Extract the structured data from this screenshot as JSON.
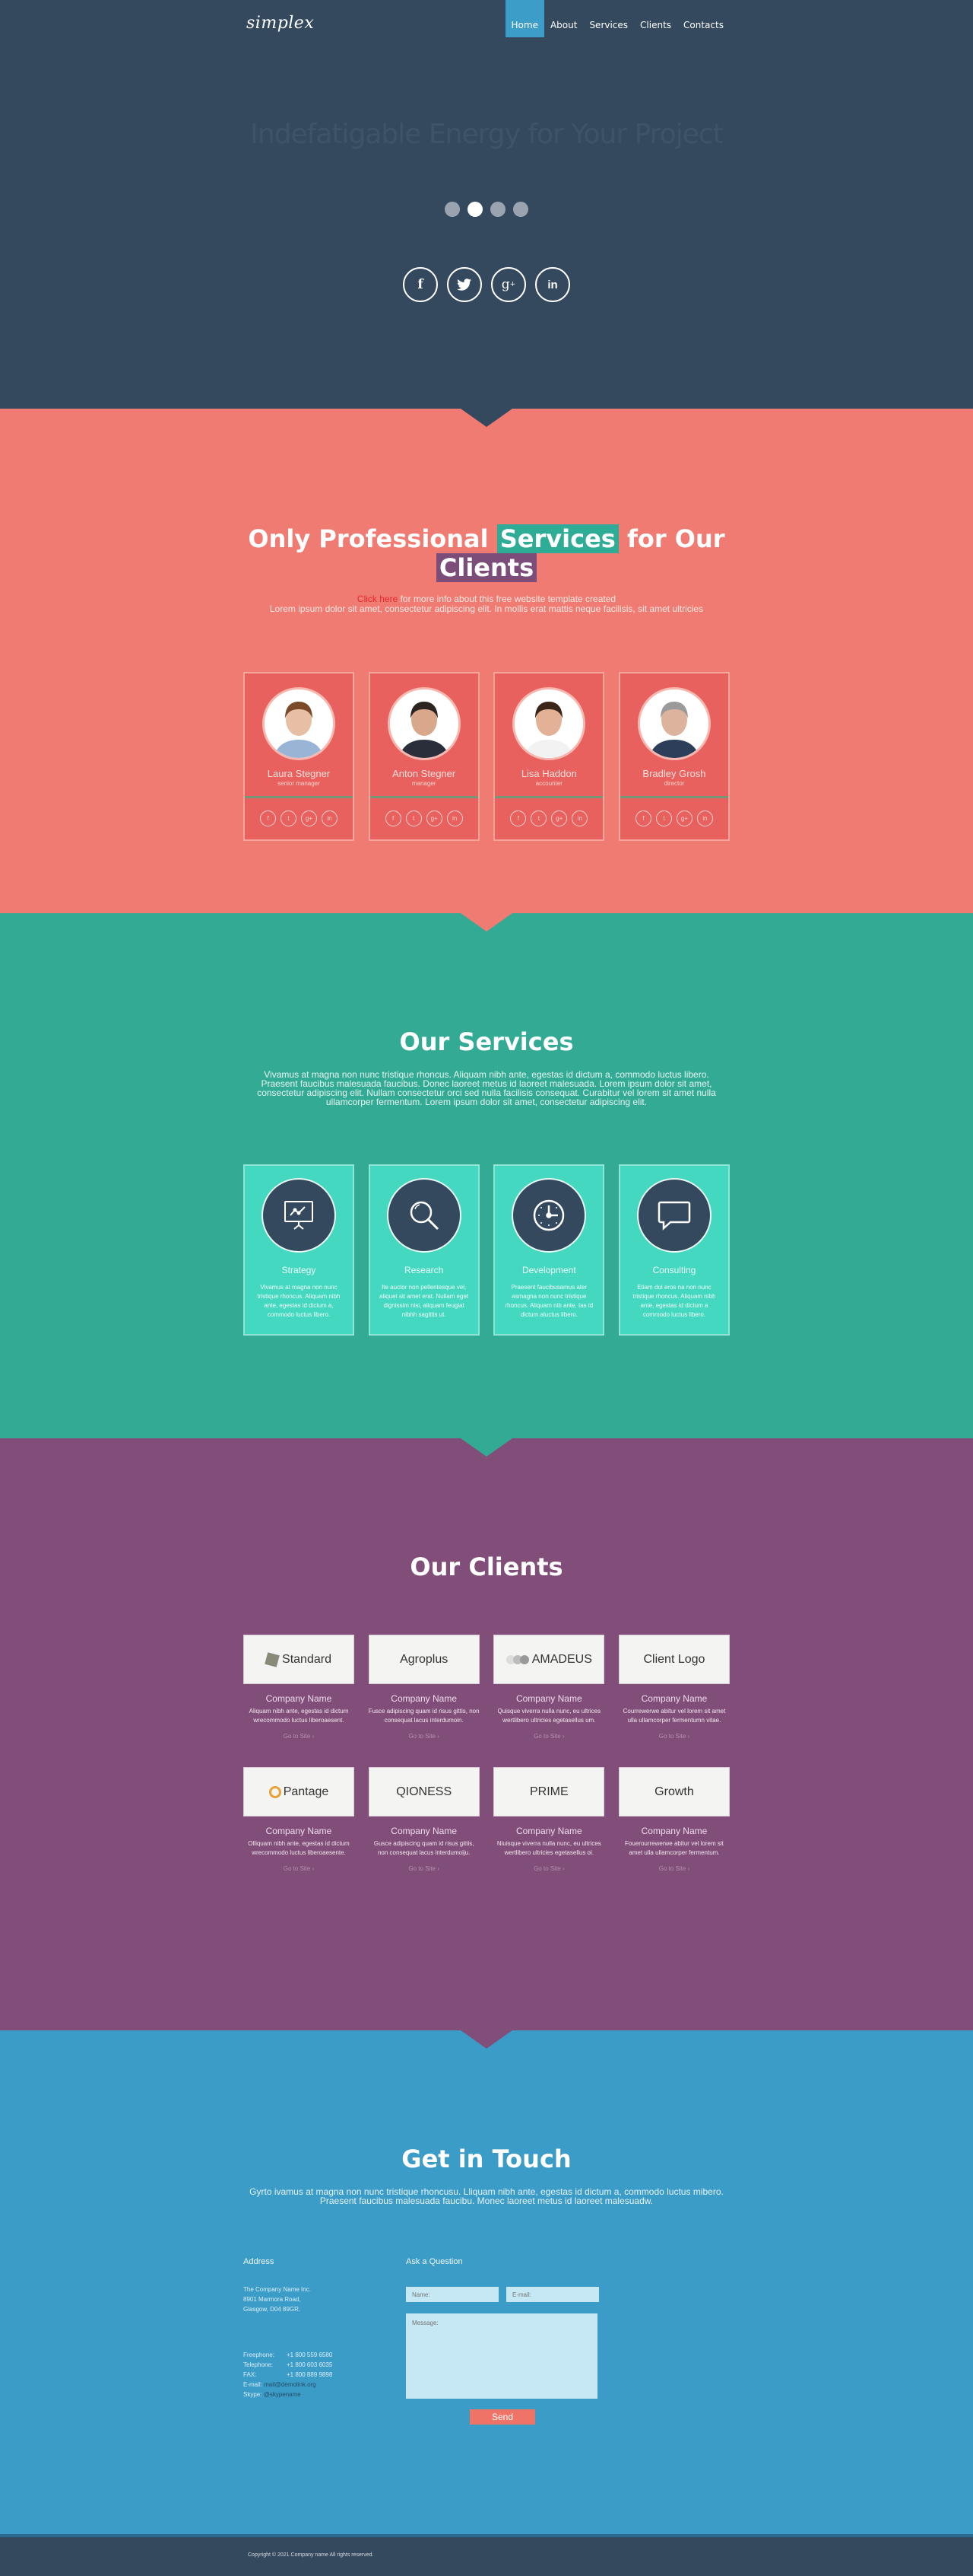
{
  "header": {
    "logo": "simplex",
    "nav": [
      {
        "label": "Home",
        "active": true
      },
      {
        "label": "About",
        "active": false
      },
      {
        "label": "Services",
        "active": false
      },
      {
        "label": "Clients",
        "active": false
      },
      {
        "label": "Contacts",
        "active": false
      }
    ]
  },
  "hero": {
    "title": "Indefatigable Energy for Your Project",
    "slider_dots": 4,
    "active_dot": 2,
    "social": [
      {
        "icon": "facebook-icon",
        "glyph": "f"
      },
      {
        "icon": "twitter-icon",
        "glyph": "t"
      },
      {
        "icon": "google-plus-icon",
        "glyph": "g+"
      },
      {
        "icon": "linkedin-icon",
        "glyph": "in"
      }
    ]
  },
  "team": {
    "title_pre": "Only Professional",
    "title_hl1": "Services",
    "title_mid": "for Our",
    "title_hl2": "Clients",
    "link_text": "Click here",
    "intro_line1_rest": " for more info about this free website template created",
    "intro_line2": "Lorem ipsum dolor sit amet, consectetur adipiscing elit. In mollis erat mattis neque facilisis, sit amet ultricies",
    "members": [
      {
        "name": "Laura Stegner",
        "role": "senior manager"
      },
      {
        "name": "Anton Stegner",
        "role": "manager"
      },
      {
        "name": "Lisa Haddon",
        "role": "accounter"
      },
      {
        "name": "Bradley Grosh",
        "role": "director"
      }
    ],
    "member_social": [
      "f",
      "t",
      "g+",
      "in"
    ]
  },
  "services": {
    "title": "Our Services",
    "description": "Vivamus at magna non nunc tristique rhoncus. Aliquam nibh ante, egestas id dictum a, commodo luctus libero. Praesent faucibus malesuada faucibus. Donec laoreet metus id laoreet malesuada. Lorem ipsum dolor sit amet, consectetur adipiscing elit. Nullam consectetur orci sed nulla facilisis consequat. Curabitur vel lorem sit amet nulla ullamcorper fermentum. Lorem ipsum dolor sit amet, consectetur adipiscing elit.",
    "items": [
      {
        "name": "Strategy",
        "icon": "presentation-chart-icon",
        "desc": "Vivamus at magna non nunc tristique rhoncus. Aliquam nibh ante, egestas id dictum a, commodo luctus libero."
      },
      {
        "name": "Research",
        "icon": "magnifier-icon",
        "desc": "Ite auctor non pellentesque vel, aliquet sit amet erat. Nullam eget dignissim nisi, aliquam feugiat nibhh sagittis ut."
      },
      {
        "name": "Development",
        "icon": "clock-icon",
        "desc": "Praesent faucibusamus ater asmagna non nunc tristique rhoncus. Aliquam nib ante, tas id dictum aluctus libero."
      },
      {
        "name": "Consulting",
        "icon": "speech-bubble-icon",
        "desc": "Etiam dui eros na non nunc tristique rhoncus. Aliquam nibh ante, egestas id dictum a commodo luctus libero."
      }
    ]
  },
  "clients": {
    "title": "Our Clients",
    "link_label": "Go to Site ›",
    "items": [
      {
        "logo": "Standard",
        "name": "Company Name",
        "desc": "Aliquam nibh ante, egestas id dictum wrecommodo luctus liberoaesent."
      },
      {
        "logo": "Agroplus",
        "name": "Company Name",
        "desc": "Fusce adipiscing quam id risus gittis, non consequat lacus interdumoin."
      },
      {
        "logo": "AMADEUS",
        "name": "Company Name",
        "desc": "Quisque viverra nulla nunc, eu ultrices wertlibero ultricies egetasellus um."
      },
      {
        "logo": "Client Logo",
        "name": "Company Name",
        "desc": "Courrewerwe abitur vel lorem sit amet ulla ullamcorper fermentumn vitae."
      },
      {
        "logo": "Pantage",
        "name": "Company Name",
        "desc": "Olliquam nibh ante, egestas id dictum wrecommodo luctus liberoaesente."
      },
      {
        "logo": "QIONESS",
        "name": "Company Name",
        "desc": "Gusce adipiscing quam id risus gittis, non consequat lacus interdumoiju."
      },
      {
        "logo": "PRIME",
        "name": "Company Name",
        "desc": "Niuisque viverra nulla nunc, eu ultrices wertlibero ultricies egetasellus oi."
      },
      {
        "logo": "Growth",
        "name": "Company Name",
        "desc": "Fouerourrewerwe abitur vel lorem sit amet ulla ullamcorper fermentum."
      }
    ]
  },
  "contact": {
    "title": "Get in Touch",
    "description": "Gyrto ivamus at magna non nunc tristique rhoncusu. Lliquam nibh ante, egestas id dictum a, commodo luctus mibero. Praesent faucibus malesuada faucibu. Monec laoreet metus id laoreet malesuadw.",
    "address_title": "Address",
    "address_lines": [
      "The Company Name Inc.",
      "8901 Marmora Road,",
      "Glasgow, D04 89GR."
    ],
    "freephone_label": "Freephone:",
    "freephone": "+1 800 559 6580",
    "telephone_label": "Telephone:",
    "telephone": "+1 800 603 6035",
    "fax_label": "FAX:",
    "fax": "+1 800 889 9898",
    "email_label": "E-mail:",
    "email": "mail@demolink.org",
    "skype_label": "Skype:",
    "skype": "@skypename",
    "form_title": "Ask a Question",
    "name_placeholder": "Name:",
    "email_placeholder": "E-mail:",
    "message_placeholder": "Message:",
    "send_label": "Send"
  },
  "footer": {
    "copyright": "Copyright © 2021.Company name All rights reserved."
  },
  "colors": {
    "dark": "#34495e",
    "coral": "#f07b72",
    "teal": "#33ab94",
    "purple": "#804e78",
    "blue": "#3c9cc8",
    "nav_active": "#3d9dc9"
  }
}
